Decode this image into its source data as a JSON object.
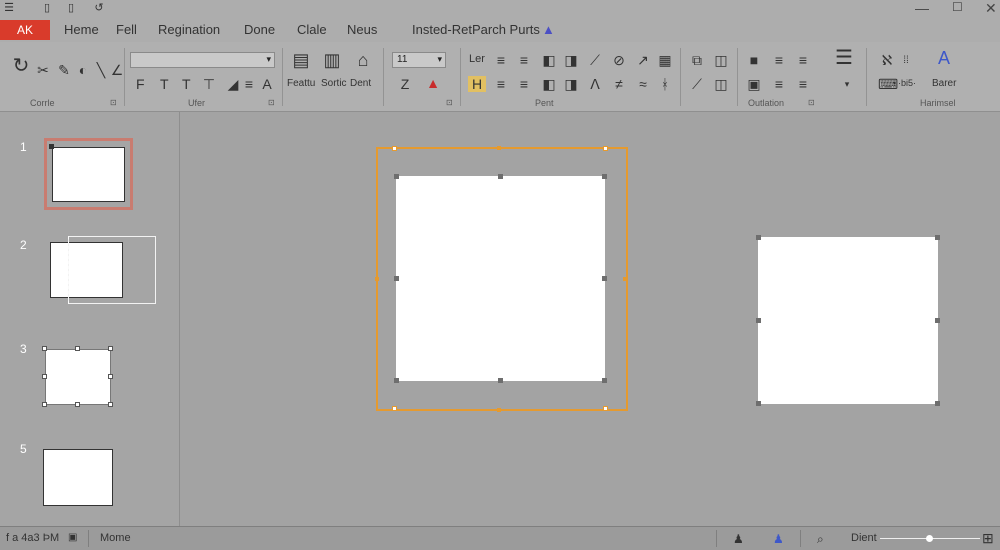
{
  "menubar": {
    "file_tab": "AK",
    "items": [
      "Heme",
      "Fell",
      "Regination",
      "Done",
      "Clale",
      "Neus"
    ],
    "doc_title": "Insted-RetParch Purts"
  },
  "ribbon": {
    "row2_letters": [
      "F",
      "T",
      "T"
    ],
    "labels": {
      "feature": "Feattu",
      "sortic": "Sortic",
      "dent": "Dent",
      "font_size": "11",
      "ler": "Ler",
      "paste_opt": "·bi5·",
      "barer": "Barer"
    },
    "groups": [
      "Corrle",
      "Ufer",
      "Pent",
      "Outlation",
      "Harimsel"
    ]
  },
  "slides": {
    "numbers": [
      "1",
      "2",
      "3",
      "5"
    ]
  },
  "statusbar": {
    "left_text": "f a 4a3 ÞM",
    "mode": "Mome",
    "zoom_label": "Dient"
  },
  "colors": {
    "file_tab": "#d93b2b",
    "selection": "#e59a2f",
    "slide_thumb_highlight": "#c97c70"
  }
}
